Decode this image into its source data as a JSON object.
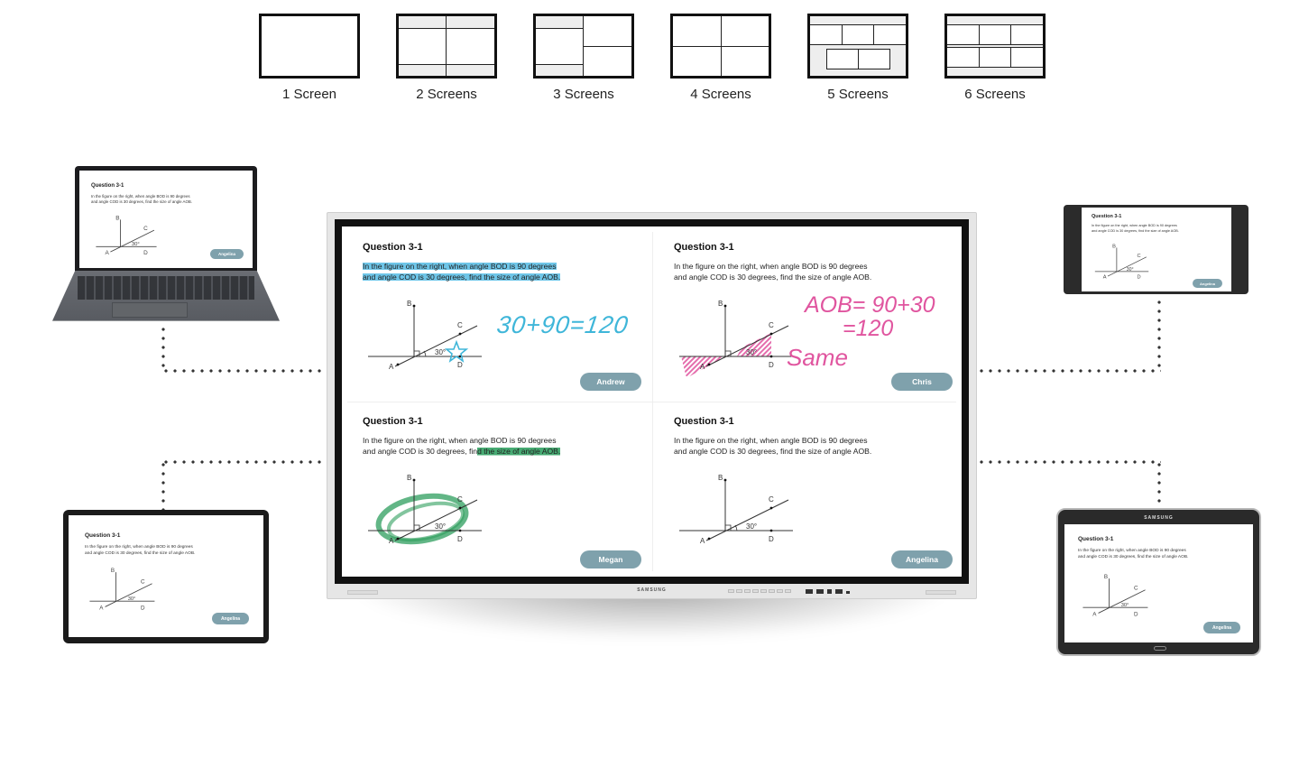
{
  "layout_modes": [
    {
      "label": "1 Screen",
      "layout": "single"
    },
    {
      "label": "2 Screens",
      "layout": "two-columns"
    },
    {
      "label": "3 Screens",
      "layout": "one-left-two-right"
    },
    {
      "label": "4 Screens",
      "layout": "2x2-grid"
    },
    {
      "label": "5 Screens",
      "layout": "three-top-two-bottom"
    },
    {
      "label": "6 Screens",
      "layout": "2x3-grid"
    }
  ],
  "board": {
    "brand": "SAMSUNG",
    "quadrants": [
      {
        "title": "Question 3-1",
        "text_line1": "In the figure on the right, when angle BOD is 90 degrees",
        "text_line2": "and angle COD is 30 degrees, find the size of angle AOB.",
        "student": "Andrew",
        "annotation": "30+90=120",
        "ink_color": "#3fb6d9"
      },
      {
        "title": "Question 3-1",
        "text_line1": "In the figure on the right, when angle BOD is 90 degrees",
        "text_line2": "and angle COD is 30 degrees, find the size of angle AOB.",
        "student": "Chris",
        "annotation_line1": "AOB= 90+30",
        "annotation_line2": "=120",
        "annotation_line3": "Same",
        "ink_color": "#e0559f"
      },
      {
        "title": "Question 3-1",
        "text_line1": "In the figure on the right, when angle BOD is 90 degrees",
        "text_line2_a": "and angle COD is 30 degrees, fin",
        "text_line2_b": "d the size of angle AOB.",
        "student": "Megan",
        "ink_color": "#2e9e5e"
      },
      {
        "title": "Question 3-1",
        "text_line1": "In the figure on the right, when angle BOD is 90 degrees",
        "text_line2": "and angle COD is 30 degrees, find the size of angle AOB.",
        "student": "Angelina"
      }
    ],
    "figure_labels": {
      "a": "A",
      "b": "B",
      "c": "C",
      "d": "D",
      "angle": "30°"
    }
  },
  "devices": [
    {
      "type": "laptop",
      "title": "Question 3-1",
      "text_line1": "In the figure on the right, when angle BOD is 90 degrees",
      "text_line2": "and angle COD is 30 degrees, find the size of angle AOB.",
      "student": "Angelina"
    },
    {
      "type": "phone",
      "title": "Question 3-1",
      "text_line1": "In the figure on the right, when angle BOD is 90 degrees",
      "text_line2": "and angle COD is 30 degrees, find the size of angle AOB.",
      "student": "Angelina"
    },
    {
      "type": "tablet-left",
      "title": "Question 3-1",
      "text_line1": "In the figure on the right, when angle BOD is 90 degrees",
      "text_line2": "and angle COD is 30 degrees, find the size of angle AOB.",
      "student": "Angelina"
    },
    {
      "type": "tablet-right",
      "brand": "SAMSUNG",
      "title": "Question 3-1",
      "text_line1": "In the figure on the right, when angle BOD is 90 degrees",
      "text_line2": "and angle COD is 30 degrees, find the size of angle AOB.",
      "student": "Angelina"
    }
  ],
  "colors": {
    "button": "#7fa1ac",
    "highlight_blue": "#3eb2e0",
    "ink_pink": "#e0559f",
    "ink_green": "#2e9e5e"
  }
}
